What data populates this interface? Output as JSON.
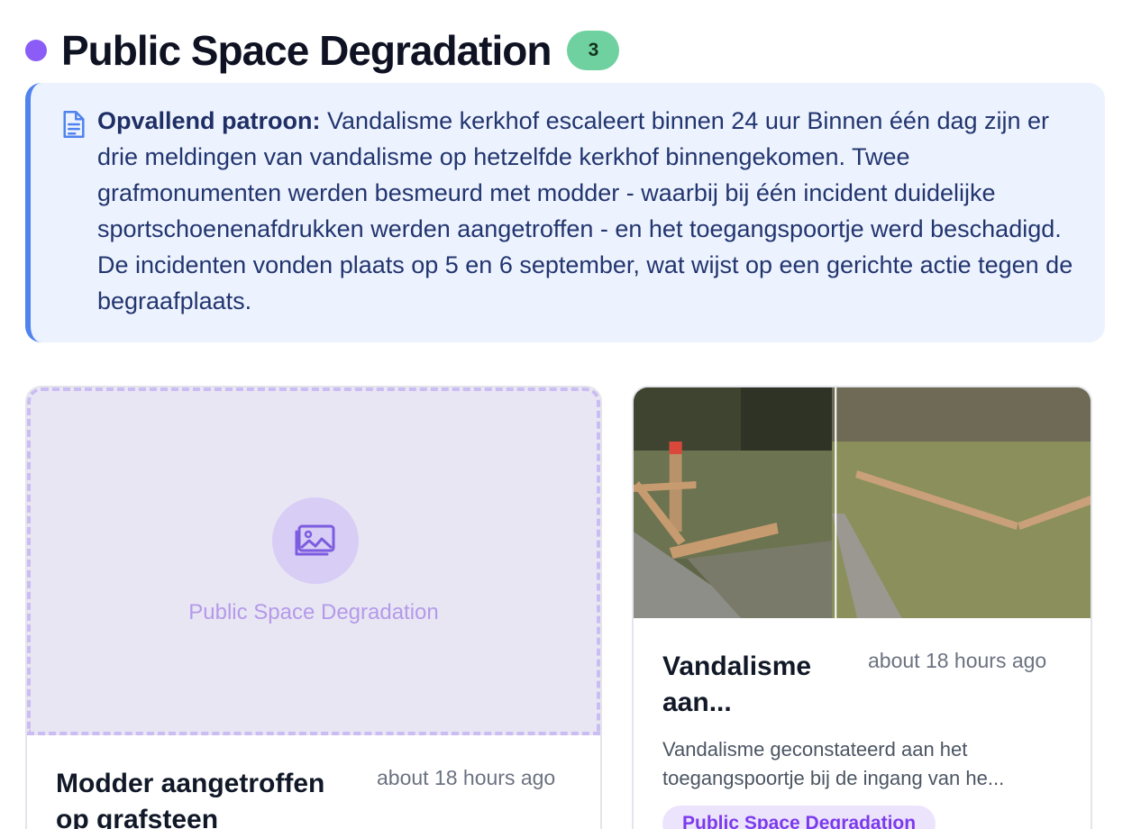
{
  "header": {
    "title": "Public Space Degradation",
    "count": "3",
    "dot_color": "#8b5cf6"
  },
  "callout": {
    "icon": "document-icon",
    "label": "Opvallend patroon:",
    "text": "Vandalisme kerkhof escaleert binnen 24 uur Binnen één dag zijn er drie meldingen van vandalisme op hetzelfde kerkhof binnengekomen. Twee grafmonumenten werden besmeurd met modder - waarbij bij één incident duidelijke sportschoenenafdrukken werden aangetroffen - en het toegangspoortje werd beschadigd. De incidenten vonden plaats op 5 en 6 september, wat wijst op een gerichte actie tegen de begraafplaats."
  },
  "cards": [
    {
      "placeholder_icon": "image-icon",
      "placeholder_label": "Public Space Degradation",
      "title": "Modder aangetroffen op grafsteen",
      "time": "about 18 hours ago"
    },
    {
      "image": "photo of knocked-over wooden posts",
      "title": "Vandalisme aan...",
      "time": "about 18 hours ago",
      "description": "Vandalisme geconstateerd aan het toegangspoortje bij de ingang van he...",
      "tag": "Public Space Degradation"
    }
  ],
  "colors": {
    "accent_purple": "#8b5cf6",
    "badge_green": "#6fd19f",
    "callout_bg": "#edf3fe",
    "callout_border": "#4f83ee"
  }
}
